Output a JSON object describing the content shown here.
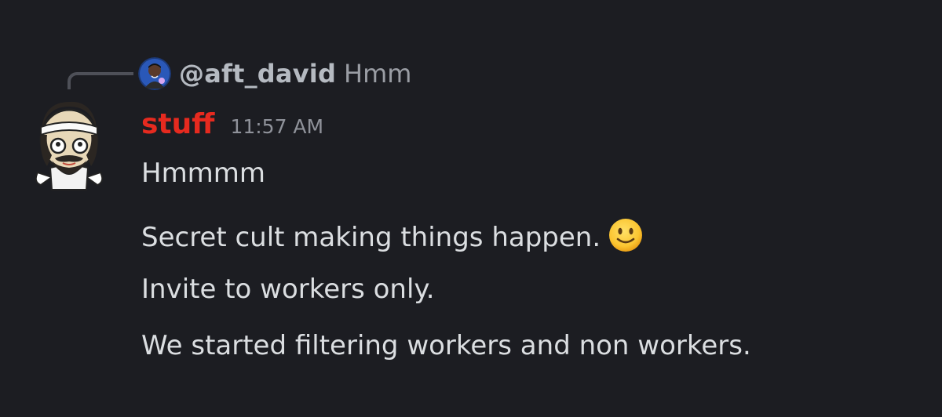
{
  "reply": {
    "username": "@aft_david",
    "text": "Hmm",
    "avatar_icon": "user-photo-avatar"
  },
  "message": {
    "username": "stuff",
    "username_color": "#e62a1f",
    "timestamp": "11:57 AM",
    "avatar_icon": "cartoon-bandana-avatar",
    "lines": [
      "Hmmmm",
      "Secret cult making things happen.",
      "Invite to workers only.",
      "We started filtering workers and non workers."
    ],
    "emoji_icon": "slightly-smiling-face-emoji"
  }
}
